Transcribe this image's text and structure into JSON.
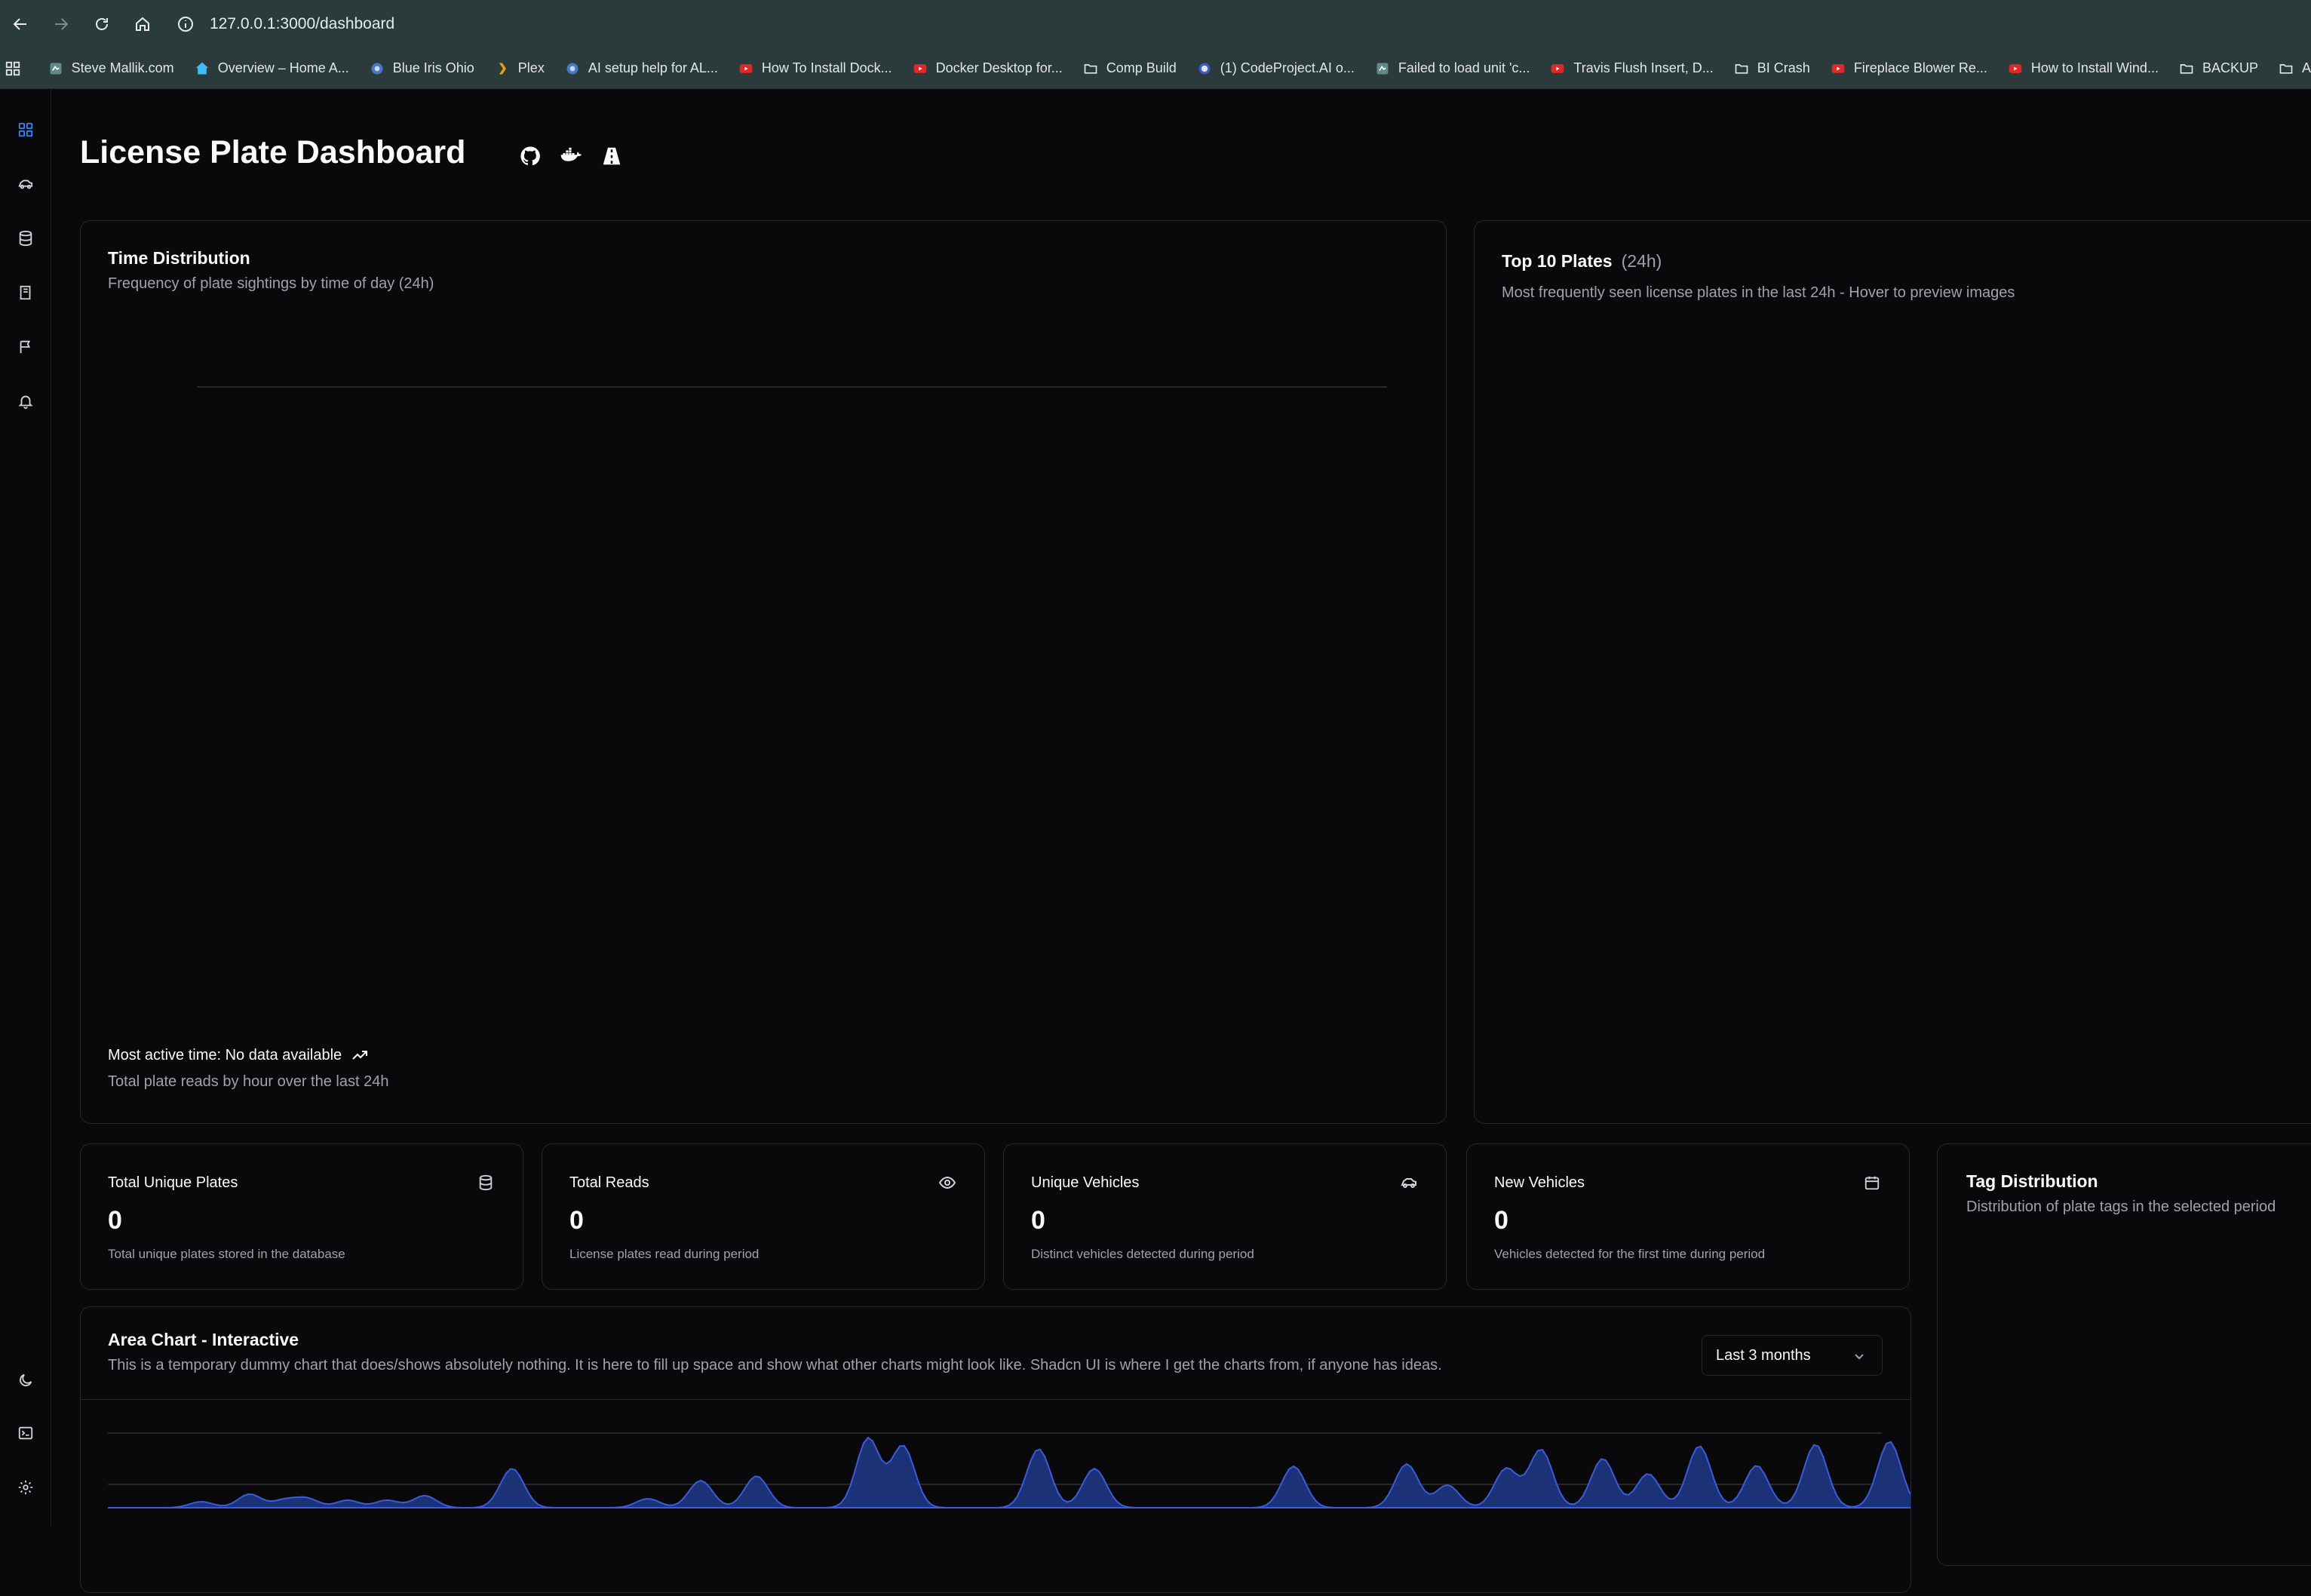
{
  "browser": {
    "url": "127.0.0.1:3000/dashboard",
    "bookmarks": [
      {
        "label": "Steve Mallik.com",
        "icon": "site-favicon-icon"
      },
      {
        "label": "Overview – Home A...",
        "icon": "home-assistant-icon"
      },
      {
        "label": "Blue Iris Ohio",
        "icon": "blue-iris-icon"
      },
      {
        "label": "Plex",
        "icon": "plex-icon"
      },
      {
        "label": "AI setup help for AL...",
        "icon": "blue-iris-icon"
      },
      {
        "label": "How To Install Dock...",
        "icon": "youtube-icon"
      },
      {
        "label": "Docker Desktop for...",
        "icon": "youtube-icon"
      },
      {
        "label": "Comp Build",
        "icon": "folder-icon"
      },
      {
        "label": "(1) CodeProject.AI o...",
        "icon": "codeproject-icon"
      },
      {
        "label": "Failed to load unit 'c...",
        "icon": "site-favicon-icon"
      },
      {
        "label": "Travis Flush Insert, D...",
        "icon": "youtube-icon"
      },
      {
        "label": "BI Crash",
        "icon": "folder-icon"
      },
      {
        "label": "Fireplace Blower Re...",
        "icon": "youtube-icon"
      },
      {
        "label": "How to Install Wind...",
        "icon": "youtube-icon"
      },
      {
        "label": "BACKUP",
        "icon": "folder-icon"
      },
      {
        "label": "A",
        "icon": "folder-icon"
      }
    ]
  },
  "page": {
    "title": "License Plate Dashboard"
  },
  "time_distribution": {
    "title": "Time Distribution",
    "subtitle": "Frequency of plate sightings by time of day (24h)",
    "footer_label": "Most active time: No data available",
    "footer_sub": "Total plate reads by hour over the last 24h"
  },
  "top_plates": {
    "title": "Top 10 Plates",
    "period": "(24h)",
    "subtitle": "Most frequently seen license plates in the last 24h - Hover to preview images"
  },
  "stats": [
    {
      "label": "Total Unique Plates",
      "value": "0",
      "desc": "Total unique plates stored in the database",
      "icon": "database-icon"
    },
    {
      "label": "Total Reads",
      "value": "0",
      "desc": "License plates read during period",
      "icon": "eye-icon"
    },
    {
      "label": "Unique Vehicles",
      "value": "0",
      "desc": "Distinct vehicles detected during period",
      "icon": "car-icon"
    },
    {
      "label": "New Vehicles",
      "value": "0",
      "desc": "Vehicles detected for the first time during period",
      "icon": "calendar-icon"
    }
  ],
  "tag_distribution": {
    "title": "Tag Distribution",
    "subtitle": "Distribution of plate tags in the selected period"
  },
  "area_chart": {
    "title": "Area Chart - Interactive",
    "subtitle": "This is a temporary dummy chart that does/shows absolutely nothing. It is here to fill up space and show what other charts might look like. Shadcn UI is where I get the charts from, if anyone has ideas.",
    "range_selected": "Last 3 months",
    "fill_color": "#1e3a8a",
    "stroke_color": "#3b5bdb"
  },
  "colors": {
    "background": "#09090b",
    "border": "#27272a",
    "accent": "#3b82f6",
    "muted_text": "#a1a1aa",
    "chrome": "#2b3a3a"
  },
  "chart_data": [
    {
      "type": "bar",
      "title": "Time Distribution",
      "categories": [],
      "values": []
    },
    {
      "type": "area",
      "title": "Area Chart - Interactive",
      "x": [],
      "series": []
    }
  ]
}
